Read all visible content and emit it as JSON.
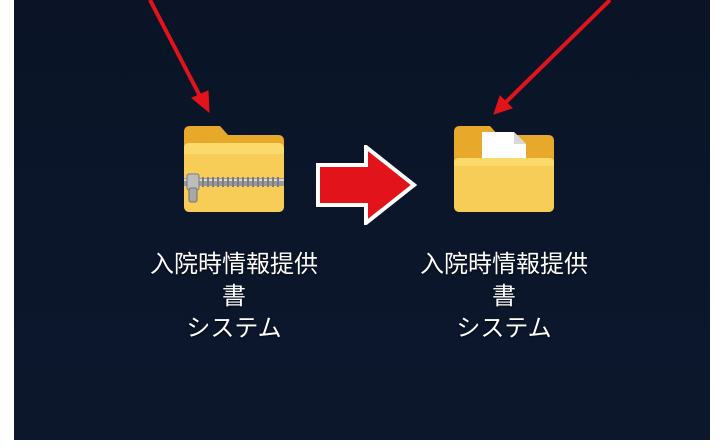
{
  "desktop": {
    "icons": [
      {
        "label": "入院時情報提供書\nシステム",
        "icon": "zip-folder-icon"
      },
      {
        "label": "入院時情報提供書\nシステム",
        "icon": "folder-icon"
      }
    ]
  },
  "annotations": {
    "transition_arrow": "right-arrow-icon",
    "pointer_color": "#e3131b"
  }
}
